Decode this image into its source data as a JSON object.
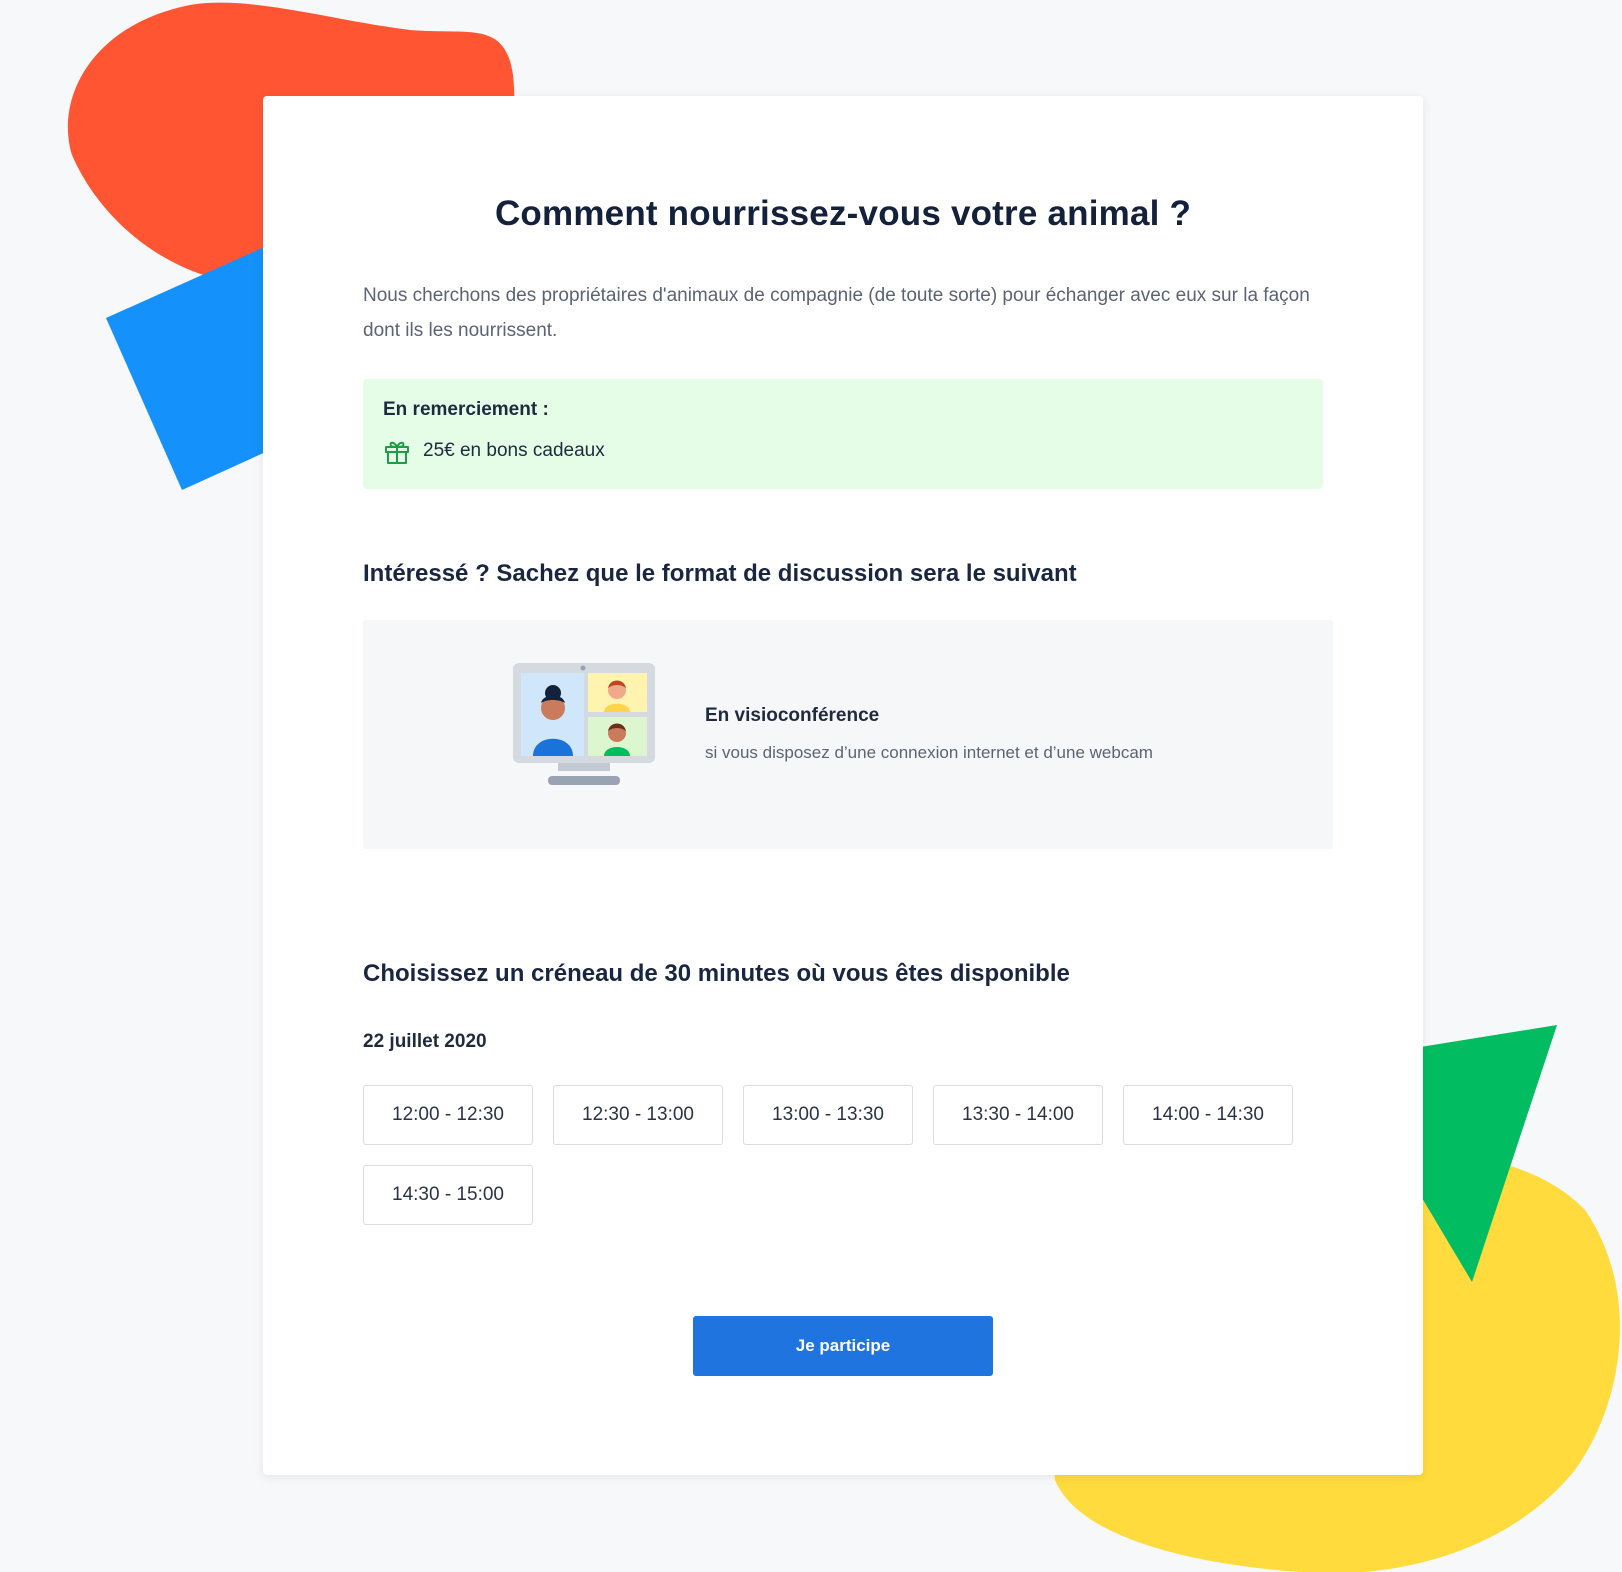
{
  "survey": {
    "title": "Comment nourrissez-vous votre animal ?",
    "intro": "Nous cherchons des propriétaires d'animaux de compagnie (de toute sorte) pour échanger avec eux sur la façon dont ils les nourrissent."
  },
  "reward": {
    "title": "En remerciement :",
    "icon": "gift-icon",
    "text": "25€ en bons cadeaux"
  },
  "format": {
    "heading": "Intéressé ? Sachez que le format de discussion sera le suivant",
    "icon": "video-conference-icon",
    "title": "En visioconférence",
    "subtitle": "si vous disposez d’une connexion internet et d’une webcam"
  },
  "slots": {
    "heading": "Choisissez un créneau de 30 minutes où vous êtes disponible",
    "date": "22 juillet 2020",
    "times": [
      "12:00 - 12:30",
      "12:30 - 13:00",
      "13:00 - 13:30",
      "13:30 - 14:00",
      "14:00 - 14:30",
      "14:30 - 15:00"
    ]
  },
  "cta": {
    "label": "Je participe"
  },
  "colors": {
    "background": "#f7f8fa",
    "card": "#ffffff",
    "reward_bg": "#e5fde7",
    "reward_icon": "#1f9d45",
    "format_bg": "#f6f7f9",
    "cta": "#1f74e0",
    "shape_orange": "#ff5533",
    "shape_blue": "#1591fb",
    "shape_green": "#02bc62",
    "shape_yellow": "#ffdb3d"
  }
}
